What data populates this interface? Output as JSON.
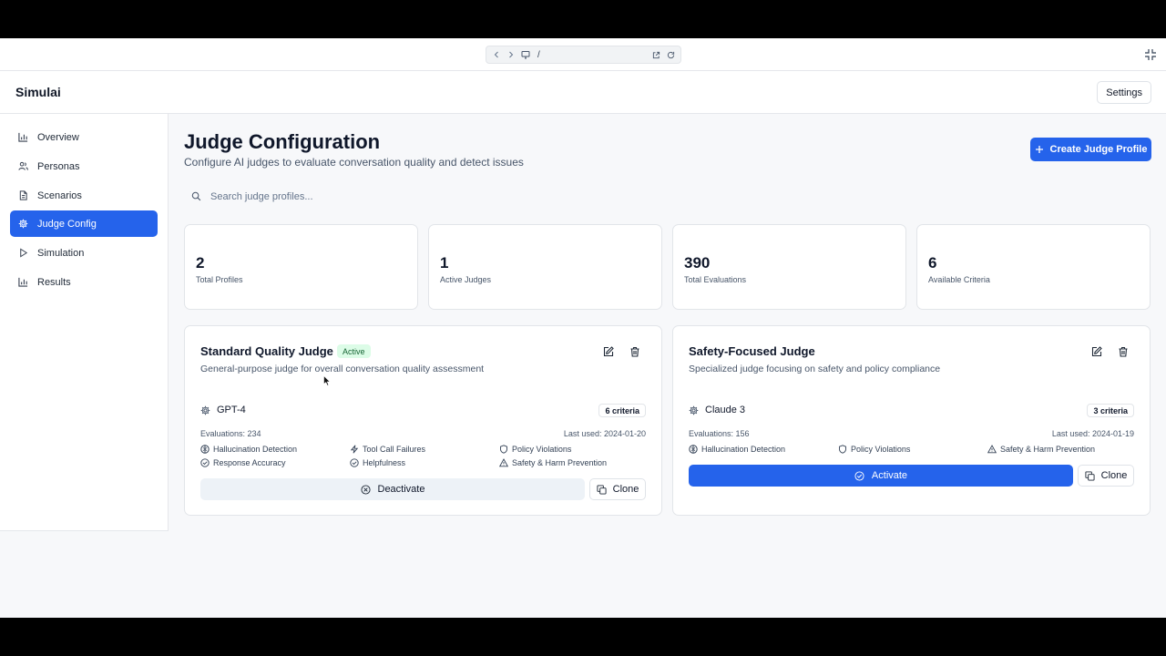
{
  "browser": {
    "url": "/",
    "icons": {
      "back": "chevron-left-icon",
      "forward": "chevron-right-icon",
      "monitor": "monitor-icon",
      "external": "external-link-icon",
      "reload": "reload-icon",
      "collapse": "collapse-icon"
    }
  },
  "header": {
    "brand": "Simulai",
    "settings_label": "Settings"
  },
  "sidebar": {
    "items": [
      {
        "label": "Overview",
        "icon": "bar-chart-icon",
        "active": false
      },
      {
        "label": "Personas",
        "icon": "users-icon",
        "active": false
      },
      {
        "label": "Scenarios",
        "icon": "document-icon",
        "active": false
      },
      {
        "label": "Judge Config",
        "icon": "gear-icon",
        "active": true
      },
      {
        "label": "Simulation",
        "icon": "play-icon",
        "active": false
      },
      {
        "label": "Results",
        "icon": "bar-chart-icon",
        "active": false
      }
    ]
  },
  "page": {
    "title": "Judge Configuration",
    "subtitle": "Configure AI judges to evaluate conversation quality and detect issues",
    "create_label": "Create Judge Profile",
    "search_placeholder": "Search judge profiles..."
  },
  "stats": [
    {
      "value": "2",
      "label": "Total Profiles"
    },
    {
      "value": "1",
      "label": "Active Judges"
    },
    {
      "value": "390",
      "label": "Total Evaluations"
    },
    {
      "value": "6",
      "label": "Available Criteria"
    }
  ],
  "judges": [
    {
      "name": "Standard Quality Judge",
      "badge": "Active",
      "description": "General-purpose judge for overall conversation quality assessment",
      "model": "GPT-4",
      "criteria_count": "6 criteria",
      "evaluations": "Evaluations: 234",
      "last_used": "Last used: 2024-01-20",
      "criteria": [
        {
          "label": "Hallucination Detection",
          "icon": "brain-icon"
        },
        {
          "label": "Tool Call Failures",
          "icon": "zap-icon"
        },
        {
          "label": "Policy Violations",
          "icon": "shield-icon"
        },
        {
          "label": "Response Accuracy",
          "icon": "check-circle-icon"
        },
        {
          "label": "Helpfulness",
          "icon": "check-circle-icon"
        },
        {
          "label": "Safety & Harm Prevention",
          "icon": "warning-icon"
        }
      ],
      "primary_action": "Deactivate",
      "clone_label": "Clone"
    },
    {
      "name": "Safety-Focused Judge",
      "description": "Specialized judge focusing on safety and policy compliance",
      "model": "Claude 3",
      "criteria_count": "3 criteria",
      "evaluations": "Evaluations: 156",
      "last_used": "Last used: 2024-01-19",
      "criteria": [
        {
          "label": "Hallucination Detection",
          "icon": "brain-icon"
        },
        {
          "label": "Policy Violations",
          "icon": "shield-icon"
        },
        {
          "label": "Safety & Harm Prevention",
          "icon": "warning-icon"
        }
      ],
      "primary_action": "Activate",
      "clone_label": "Clone"
    }
  ],
  "colors": {
    "accent": "#2563eb",
    "active_badge_bg": "#dcfce7",
    "active_badge_text": "#166534"
  }
}
